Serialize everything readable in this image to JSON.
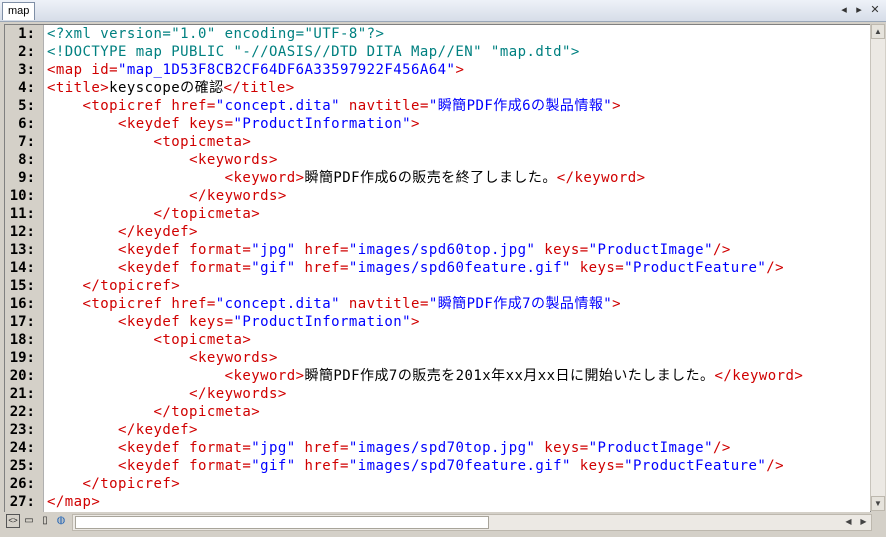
{
  "tab": {
    "label": "map"
  },
  "window_controls": {
    "prev": "◂",
    "next": "▸",
    "close": "✕"
  },
  "scroll_arrows": {
    "up": "▲",
    "down": "▼",
    "left": "◀",
    "right": "▶"
  },
  "status_icons": [
    "tag-view-icon",
    "outline-icon",
    "document-icon",
    "globe-icon"
  ],
  "colors": {
    "tag": "#d00000",
    "value": "#0000ff",
    "pi": "#008080",
    "text": "#000000",
    "gutter": "#d4d0c8"
  },
  "code_lines": [
    [
      [
        "pi",
        "<?xml version=\"1.0\" encoding=\"UTF-8\"?>"
      ]
    ],
    [
      [
        "pi",
        "<!DOCTYPE map PUBLIC \"-//OASIS//DTD DITA Map//EN\" \"map.dtd\">"
      ]
    ],
    [
      [
        "tag",
        "<map "
      ],
      [
        "attr",
        "id="
      ],
      [
        "val",
        "\"map_1D53F8CB2CF64DF6A33597922F456A64\""
      ],
      [
        "tag",
        ">"
      ]
    ],
    [
      [
        "tag",
        "<title>"
      ],
      [
        "plain",
        "keyscopeの確認"
      ],
      [
        "tag",
        "</title>"
      ]
    ],
    [
      [
        "plain",
        "    "
      ],
      [
        "tag",
        "<topicref "
      ],
      [
        "attr",
        "href="
      ],
      [
        "val",
        "\"concept.dita\""
      ],
      [
        "attr",
        " navtitle="
      ],
      [
        "val",
        "\"瞬簡PDF作成6の製品情報\""
      ],
      [
        "tag",
        ">"
      ]
    ],
    [
      [
        "plain",
        "        "
      ],
      [
        "tag",
        "<keydef "
      ],
      [
        "attr",
        "keys="
      ],
      [
        "val",
        "\"ProductInformation\""
      ],
      [
        "tag",
        ">"
      ]
    ],
    [
      [
        "plain",
        "            "
      ],
      [
        "tag",
        "<topicmeta>"
      ]
    ],
    [
      [
        "plain",
        "                "
      ],
      [
        "tag",
        "<keywords>"
      ]
    ],
    [
      [
        "plain",
        "                    "
      ],
      [
        "tag",
        "<keyword>"
      ],
      [
        "plain",
        "瞬簡PDF作成6の販売を終了しました。"
      ],
      [
        "tag",
        "</keyword>"
      ]
    ],
    [
      [
        "plain",
        "                "
      ],
      [
        "tag",
        "</keywords>"
      ]
    ],
    [
      [
        "plain",
        "            "
      ],
      [
        "tag",
        "</topicmeta>"
      ]
    ],
    [
      [
        "plain",
        "        "
      ],
      [
        "tag",
        "</keydef>"
      ]
    ],
    [
      [
        "plain",
        "        "
      ],
      [
        "tag",
        "<keydef "
      ],
      [
        "attr",
        "format="
      ],
      [
        "val",
        "\"jpg\""
      ],
      [
        "attr",
        " href="
      ],
      [
        "val",
        "\"images/spd60top.jpg\""
      ],
      [
        "attr",
        " keys="
      ],
      [
        "val",
        "\"ProductImage\""
      ],
      [
        "tag",
        "/>"
      ]
    ],
    [
      [
        "plain",
        "        "
      ],
      [
        "tag",
        "<keydef "
      ],
      [
        "attr",
        "format="
      ],
      [
        "val",
        "\"gif\""
      ],
      [
        "attr",
        " href="
      ],
      [
        "val",
        "\"images/spd60feature.gif\""
      ],
      [
        "attr",
        " keys="
      ],
      [
        "val",
        "\"ProductFeature\""
      ],
      [
        "tag",
        "/>"
      ]
    ],
    [
      [
        "plain",
        "    "
      ],
      [
        "tag",
        "</topicref>"
      ]
    ],
    [
      [
        "plain",
        "    "
      ],
      [
        "tag",
        "<topicref "
      ],
      [
        "attr",
        "href="
      ],
      [
        "val",
        "\"concept.dita\""
      ],
      [
        "attr",
        " navtitle="
      ],
      [
        "val",
        "\"瞬簡PDF作成7の製品情報\""
      ],
      [
        "tag",
        ">"
      ]
    ],
    [
      [
        "plain",
        "        "
      ],
      [
        "tag",
        "<keydef "
      ],
      [
        "attr",
        "keys="
      ],
      [
        "val",
        "\"ProductInformation\""
      ],
      [
        "tag",
        ">"
      ]
    ],
    [
      [
        "plain",
        "            "
      ],
      [
        "tag",
        "<topicmeta>"
      ]
    ],
    [
      [
        "plain",
        "                "
      ],
      [
        "tag",
        "<keywords>"
      ]
    ],
    [
      [
        "plain",
        "                    "
      ],
      [
        "tag",
        "<keyword>"
      ],
      [
        "plain",
        "瞬簡PDF作成7の販売を201x年xx月xx日に開始いたしました。"
      ],
      [
        "tag",
        "</keyword>"
      ]
    ],
    [
      [
        "plain",
        "                "
      ],
      [
        "tag",
        "</keywords>"
      ]
    ],
    [
      [
        "plain",
        "            "
      ],
      [
        "tag",
        "</topicmeta>"
      ]
    ],
    [
      [
        "plain",
        "        "
      ],
      [
        "tag",
        "</keydef>"
      ]
    ],
    [
      [
        "plain",
        "        "
      ],
      [
        "tag",
        "<keydef "
      ],
      [
        "attr",
        "format="
      ],
      [
        "val",
        "\"jpg\""
      ],
      [
        "attr",
        " href="
      ],
      [
        "val",
        "\"images/spd70top.jpg\""
      ],
      [
        "attr",
        " keys="
      ],
      [
        "val",
        "\"ProductImage\""
      ],
      [
        "tag",
        "/>"
      ]
    ],
    [
      [
        "plain",
        "        "
      ],
      [
        "tag",
        "<keydef "
      ],
      [
        "attr",
        "format="
      ],
      [
        "val",
        "\"gif\""
      ],
      [
        "attr",
        " href="
      ],
      [
        "val",
        "\"images/spd70feature.gif\""
      ],
      [
        "attr",
        " keys="
      ],
      [
        "val",
        "\"ProductFeature\""
      ],
      [
        "tag",
        "/>"
      ]
    ],
    [
      [
        "plain",
        "    "
      ],
      [
        "tag",
        "</topicref>"
      ]
    ],
    [
      [
        "tag",
        "</map>"
      ]
    ]
  ]
}
